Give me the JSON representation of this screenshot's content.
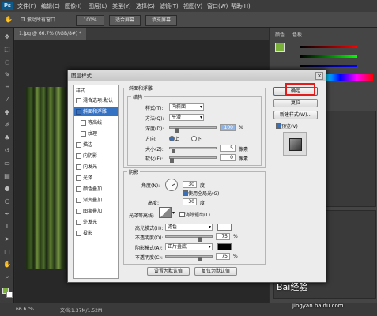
{
  "menubar": {
    "logo": "Ps",
    "items": [
      "文件(F)",
      "编辑(E)",
      "图像(I)",
      "图层(L)",
      "类型(Y)",
      "选择(S)",
      "滤镜(T)",
      "视图(V)",
      "窗口(W)",
      "帮助(H)"
    ]
  },
  "optionsbar": {
    "checkbox_label": "滚动所有窗口",
    "zoom_value": "100%",
    "fit_screen": "适合屏幕",
    "fill_screen": "填充屏幕"
  },
  "document": {
    "tab_title": "1.jpg @ 66.7% (RGB/8#) *"
  },
  "statusbar": {
    "zoom": "66.67%",
    "doc_info": "文档:1.37M/1.52M"
  },
  "panels": {
    "tab_color": "颜色",
    "tab_swatches": "色板"
  },
  "dialog": {
    "title": "图层样式",
    "close_glyph": "×",
    "style_list_header": "样式",
    "style_list": [
      {
        "label": "混合选项:默认",
        "checked": false,
        "indent": false
      },
      {
        "label": "斜面和浮雕",
        "checked": true,
        "indent": false,
        "selected": true
      },
      {
        "label": "等高线",
        "checked": false,
        "indent": true
      },
      {
        "label": "纹理",
        "checked": false,
        "indent": true
      },
      {
        "label": "描边",
        "checked": false,
        "indent": false
      },
      {
        "label": "内阴影",
        "checked": false,
        "indent": false
      },
      {
        "label": "内发光",
        "checked": false,
        "indent": false
      },
      {
        "label": "光泽",
        "checked": false,
        "indent": false
      },
      {
        "label": "颜色叠加",
        "checked": false,
        "indent": false
      },
      {
        "label": "渐变叠加",
        "checked": false,
        "indent": false
      },
      {
        "label": "图案叠加",
        "checked": false,
        "indent": false
      },
      {
        "label": "外发光",
        "checked": false,
        "indent": false
      },
      {
        "label": "投影",
        "checked": false,
        "indent": false
      }
    ],
    "section_title": "斜面和浮雕",
    "structure": {
      "title": "结构",
      "style_label": "样式(T):",
      "style_value": "内斜面",
      "technique_label": "方法(Q):",
      "technique_value": "平滑",
      "depth_label": "深度(D):",
      "depth_value": "100",
      "depth_unit": "%",
      "depth_level": 0.1,
      "direction_label": "方向:",
      "dir_up": "上",
      "dir_down": "下",
      "size_label": "大小(Z):",
      "size_value": "5",
      "size_unit": "像素",
      "size_level": 0.04,
      "soften_label": "软化(F):",
      "soften_value": "0",
      "soften_unit": "像素",
      "soften_level": 0
    },
    "shading": {
      "title": "阴影",
      "angle_label": "角度(N):",
      "angle_value": "30",
      "angle_unit": "度",
      "global_light": "使用全局光(G)",
      "altitude_label": "高度:",
      "altitude_value": "30",
      "altitude_unit": "度",
      "gloss_label": "光泽等高线:",
      "anti_alias": "消除锯齿(L)",
      "highlight_label": "高光模式(H):",
      "highlight_value": "滤色",
      "hl_opacity_label": "不透明度(O):",
      "hl_opacity_value": "75",
      "hl_opacity_level": 0.75,
      "opacity_unit": "%",
      "shadow_label": "阴影模式(A):",
      "shadow_value": "正片叠底",
      "sh_opacity_label": "不透明度(C):",
      "sh_opacity_value": "75",
      "sh_opacity_level": 0.75
    },
    "buttons": {
      "ok": "确定",
      "reset": "复位",
      "new_style": "新建样式(W)...",
      "preview": "预览(V)",
      "set_default": "设置为默认值",
      "reset_default": "复位为默认值"
    },
    "colors": {
      "highlight_swatch": "#ffffff",
      "shadow_swatch": "#000000",
      "accent": "#3572c4"
    }
  },
  "watermark": {
    "text": "Bai经验",
    "url": "jingyan.baidu.com"
  }
}
